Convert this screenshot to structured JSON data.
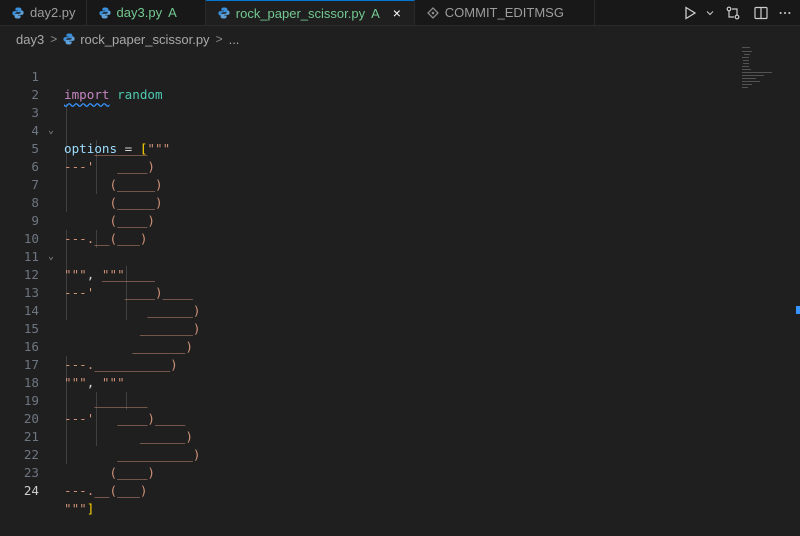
{
  "tabs": [
    {
      "label": "day2.py",
      "status": "",
      "active": false
    },
    {
      "label": "day3.py",
      "status": "A",
      "active": false
    },
    {
      "label": "rock_paper_scissor.py",
      "status": "A",
      "active": true,
      "close": "×"
    },
    {
      "label": "COMMIT_EDITMSG",
      "status": "",
      "active": false
    }
  ],
  "breadcrumb": {
    "folder": "day3",
    "file": "rock_paper_scissor.py",
    "more": "..."
  },
  "colors": {
    "accent": "#0078d4",
    "status_added": "#73c991",
    "string": "#ce9178",
    "keyword": "#c586c0"
  },
  "editor": {
    "line_numbers": [
      "1",
      "2",
      "3",
      "4",
      "5",
      "6",
      "7",
      "8",
      "9",
      "10",
      "11",
      "12",
      "13",
      "14",
      "15",
      "16",
      "17",
      "18",
      "19",
      "20",
      "21",
      "22",
      "23",
      "24"
    ],
    "l1": {
      "kw": "import",
      "rest": " random"
    },
    "l3": {
      "var": "options",
      "eq": " = ",
      "br": "[",
      "str": "\"\"\""
    },
    "l4": "    _______",
    "l5": "---'   ____)",
    "l6": "      (_____)",
    "l7": "      (_____)",
    "l8": "      (____)",
    "l9": "---.__(___)",
    "l10": {
      "s1": "\"\"\"",
      "comma": ", ",
      "s2": "\"\"\""
    },
    "l11": "     _______",
    "l12": "---'    ____)____",
    "l13": "           ______)",
    "l14": "          _______)",
    "l15": "         _______)",
    "l16": "---.__________)",
    "l17": {
      "s1": "\"\"\"",
      "comma": ", ",
      "s2": "\"\"\""
    },
    "l18": "    _______",
    "l19": "---'   ____)____",
    "l20": "          ______)",
    "l21": "       __________)",
    "l22": "      (____)",
    "l23": "---.__(___)",
    "l24": {
      "str": "\"\"\"",
      "br": "]"
    }
  },
  "icons": {
    "run": "play-icon",
    "dropdown": "chevron-down-icon",
    "compare": "compare-changes-icon",
    "split": "split-editor-icon",
    "more": "more-actions-icon"
  }
}
